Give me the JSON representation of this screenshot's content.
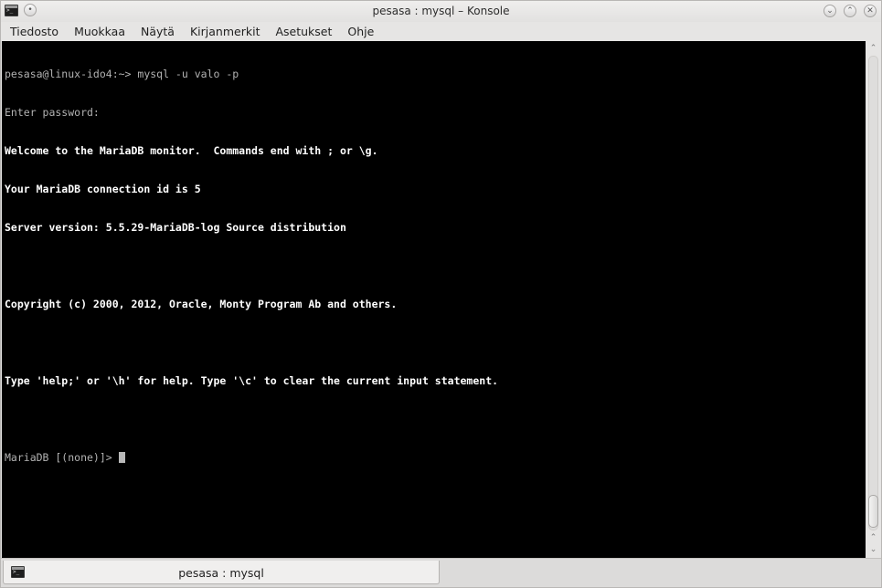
{
  "window": {
    "title": "pesasa : mysql – Konsole",
    "icon": "terminal-icon",
    "buttons": {
      "minimize": "⌄",
      "maximize": "⌃",
      "close": "✕",
      "menu": "•"
    }
  },
  "menubar": {
    "items": [
      "Tiedosto",
      "Muokkaa",
      "Näytä",
      "Kirjanmerkit",
      "Asetukset",
      "Ohje"
    ]
  },
  "terminal": {
    "lines": [
      "pesasa@linux-ido4:~> mysql -u valo -p",
      "Enter password:",
      "Welcome to the MariaDB monitor.  Commands end with ; or \\g.",
      "Your MariaDB connection id is 5",
      "Server version: 5.5.29-MariaDB-log Source distribution",
      "",
      "Copyright (c) 2000, 2012, Oracle, Monty Program Ab and others.",
      "",
      "Type 'help;' or '\\h' for help. Type '\\c' to clear the current input statement.",
      "",
      "MariaDB [(none)]> "
    ]
  },
  "scrollbar": {
    "up_arrow": "⌃",
    "down_arrow": "⌄"
  },
  "tabs": [
    {
      "label": "pesasa : mysql"
    }
  ]
}
